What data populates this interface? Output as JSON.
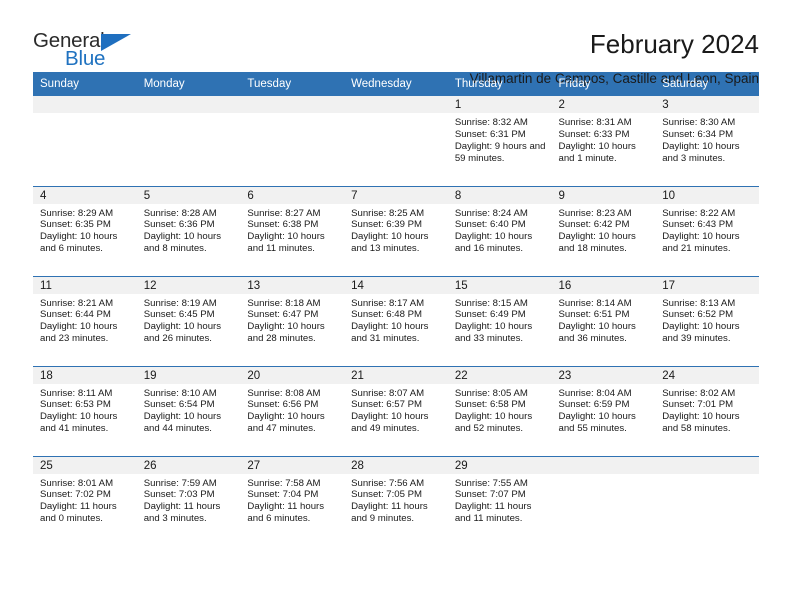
{
  "brand": {
    "name_top": "General",
    "name_bottom": "Blue",
    "triangle_icon": "triangle-icon",
    "color_top": "#2b2b2b",
    "color_bottom": "#1f72c0"
  },
  "header": {
    "title": "February 2024",
    "subtitle": "Villamartin de Campos, Castille and Leon, Spain"
  },
  "theme": {
    "header_blue": "#2f72b3",
    "day_band_gray": "#f1f1f1",
    "text": "#1a1a1a"
  },
  "calendar": {
    "weekday_headers": [
      "Sunday",
      "Monday",
      "Tuesday",
      "Wednesday",
      "Thursday",
      "Friday",
      "Saturday"
    ],
    "weeks": [
      [
        {
          "day": "",
          "empty": true
        },
        {
          "day": "",
          "empty": true
        },
        {
          "day": "",
          "empty": true
        },
        {
          "day": "",
          "empty": true
        },
        {
          "day": "1",
          "sunrise": "Sunrise: 8:32 AM",
          "sunset": "Sunset: 6:31 PM",
          "daylight": "Daylight: 9 hours and 59 minutes."
        },
        {
          "day": "2",
          "sunrise": "Sunrise: 8:31 AM",
          "sunset": "Sunset: 6:33 PM",
          "daylight": "Daylight: 10 hours and 1 minute."
        },
        {
          "day": "3",
          "sunrise": "Sunrise: 8:30 AM",
          "sunset": "Sunset: 6:34 PM",
          "daylight": "Daylight: 10 hours and 3 minutes."
        }
      ],
      [
        {
          "day": "4",
          "sunrise": "Sunrise: 8:29 AM",
          "sunset": "Sunset: 6:35 PM",
          "daylight": "Daylight: 10 hours and 6 minutes."
        },
        {
          "day": "5",
          "sunrise": "Sunrise: 8:28 AM",
          "sunset": "Sunset: 6:36 PM",
          "daylight": "Daylight: 10 hours and 8 minutes."
        },
        {
          "day": "6",
          "sunrise": "Sunrise: 8:27 AM",
          "sunset": "Sunset: 6:38 PM",
          "daylight": "Daylight: 10 hours and 11 minutes."
        },
        {
          "day": "7",
          "sunrise": "Sunrise: 8:25 AM",
          "sunset": "Sunset: 6:39 PM",
          "daylight": "Daylight: 10 hours and 13 minutes."
        },
        {
          "day": "8",
          "sunrise": "Sunrise: 8:24 AM",
          "sunset": "Sunset: 6:40 PM",
          "daylight": "Daylight: 10 hours and 16 minutes."
        },
        {
          "day": "9",
          "sunrise": "Sunrise: 8:23 AM",
          "sunset": "Sunset: 6:42 PM",
          "daylight": "Daylight: 10 hours and 18 minutes."
        },
        {
          "day": "10",
          "sunrise": "Sunrise: 8:22 AM",
          "sunset": "Sunset: 6:43 PM",
          "daylight": "Daylight: 10 hours and 21 minutes."
        }
      ],
      [
        {
          "day": "11",
          "sunrise": "Sunrise: 8:21 AM",
          "sunset": "Sunset: 6:44 PM",
          "daylight": "Daylight: 10 hours and 23 minutes."
        },
        {
          "day": "12",
          "sunrise": "Sunrise: 8:19 AM",
          "sunset": "Sunset: 6:45 PM",
          "daylight": "Daylight: 10 hours and 26 minutes."
        },
        {
          "day": "13",
          "sunrise": "Sunrise: 8:18 AM",
          "sunset": "Sunset: 6:47 PM",
          "daylight": "Daylight: 10 hours and 28 minutes."
        },
        {
          "day": "14",
          "sunrise": "Sunrise: 8:17 AM",
          "sunset": "Sunset: 6:48 PM",
          "daylight": "Daylight: 10 hours and 31 minutes."
        },
        {
          "day": "15",
          "sunrise": "Sunrise: 8:15 AM",
          "sunset": "Sunset: 6:49 PM",
          "daylight": "Daylight: 10 hours and 33 minutes."
        },
        {
          "day": "16",
          "sunrise": "Sunrise: 8:14 AM",
          "sunset": "Sunset: 6:51 PM",
          "daylight": "Daylight: 10 hours and 36 minutes."
        },
        {
          "day": "17",
          "sunrise": "Sunrise: 8:13 AM",
          "sunset": "Sunset: 6:52 PM",
          "daylight": "Daylight: 10 hours and 39 minutes."
        }
      ],
      [
        {
          "day": "18",
          "sunrise": "Sunrise: 8:11 AM",
          "sunset": "Sunset: 6:53 PM",
          "daylight": "Daylight: 10 hours and 41 minutes."
        },
        {
          "day": "19",
          "sunrise": "Sunrise: 8:10 AM",
          "sunset": "Sunset: 6:54 PM",
          "daylight": "Daylight: 10 hours and 44 minutes."
        },
        {
          "day": "20",
          "sunrise": "Sunrise: 8:08 AM",
          "sunset": "Sunset: 6:56 PM",
          "daylight": "Daylight: 10 hours and 47 minutes."
        },
        {
          "day": "21",
          "sunrise": "Sunrise: 8:07 AM",
          "sunset": "Sunset: 6:57 PM",
          "daylight": "Daylight: 10 hours and 49 minutes."
        },
        {
          "day": "22",
          "sunrise": "Sunrise: 8:05 AM",
          "sunset": "Sunset: 6:58 PM",
          "daylight": "Daylight: 10 hours and 52 minutes."
        },
        {
          "day": "23",
          "sunrise": "Sunrise: 8:04 AM",
          "sunset": "Sunset: 6:59 PM",
          "daylight": "Daylight: 10 hours and 55 minutes."
        },
        {
          "day": "24",
          "sunrise": "Sunrise: 8:02 AM",
          "sunset": "Sunset: 7:01 PM",
          "daylight": "Daylight: 10 hours and 58 minutes."
        }
      ],
      [
        {
          "day": "25",
          "sunrise": "Sunrise: 8:01 AM",
          "sunset": "Sunset: 7:02 PM",
          "daylight": "Daylight: 11 hours and 0 minutes."
        },
        {
          "day": "26",
          "sunrise": "Sunrise: 7:59 AM",
          "sunset": "Sunset: 7:03 PM",
          "daylight": "Daylight: 11 hours and 3 minutes."
        },
        {
          "day": "27",
          "sunrise": "Sunrise: 7:58 AM",
          "sunset": "Sunset: 7:04 PM",
          "daylight": "Daylight: 11 hours and 6 minutes."
        },
        {
          "day": "28",
          "sunrise": "Sunrise: 7:56 AM",
          "sunset": "Sunset: 7:05 PM",
          "daylight": "Daylight: 11 hours and 9 minutes."
        },
        {
          "day": "29",
          "sunrise": "Sunrise: 7:55 AM",
          "sunset": "Sunset: 7:07 PM",
          "daylight": "Daylight: 11 hours and 11 minutes."
        },
        {
          "day": "",
          "empty": true
        },
        {
          "day": "",
          "empty": true
        }
      ]
    ]
  }
}
